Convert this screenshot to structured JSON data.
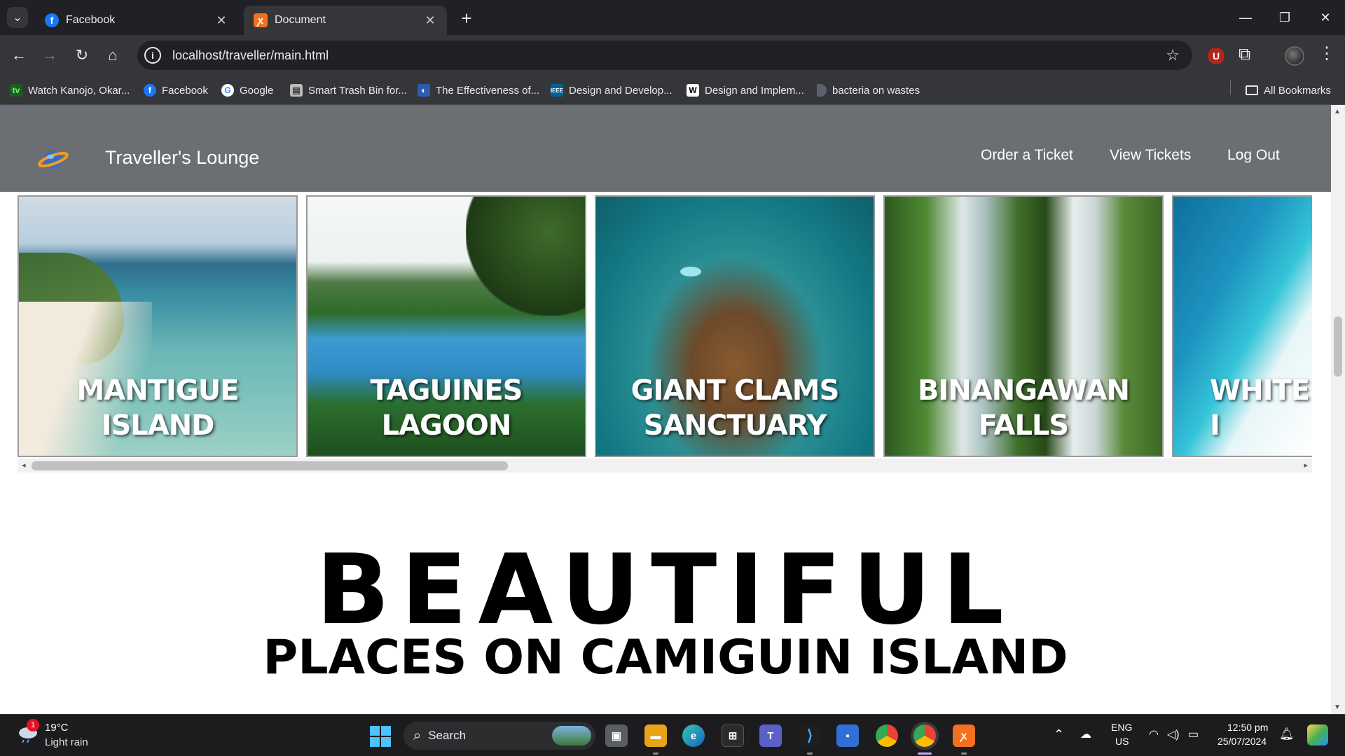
{
  "browser": {
    "tabs": [
      {
        "title": "Facebook",
        "active": false
      },
      {
        "title": "Document",
        "active": true
      }
    ],
    "url": "localhost/traveller/main.html",
    "bookmarks": [
      {
        "label": "Watch Kanojo, Okar...",
        "icon": "tv-icon"
      },
      {
        "label": "Facebook",
        "icon": "facebook-icon"
      },
      {
        "label": "Google",
        "icon": "google-icon"
      },
      {
        "label": "Smart Trash Bin for...",
        "icon": "document-icon"
      },
      {
        "label": "The Effectiveness of...",
        "icon": "globe-icon"
      },
      {
        "label": "Design and Develop...",
        "icon": "ieee-icon"
      },
      {
        "label": "Design and Implem...",
        "icon": "w-icon"
      },
      {
        "label": "bacteria on wastes",
        "icon": "bookmark-icon"
      }
    ],
    "all_bookmarks": "All Bookmarks"
  },
  "site": {
    "brand": "Traveller's Lounge",
    "nav": [
      "Order a Ticket",
      "View Tickets",
      "Log Out"
    ],
    "gallery": [
      {
        "label": "MANTIGUE ISLAND"
      },
      {
        "label": "TAGUINES LAGOON"
      },
      {
        "label": "GIANT CLAMS SANCTUARY"
      },
      {
        "label": "BINANGAWAN FALLS"
      },
      {
        "label": "WHITE I"
      }
    ],
    "hero_title": "BEAUTIFUL",
    "hero_subtitle": "PLACES ON CAMIGUIN ISLAND"
  },
  "taskbar": {
    "weather_temp": "19°C",
    "weather_desc": "Light rain",
    "weather_badge": "1",
    "search": "Search",
    "lang": "ENG",
    "region": "US",
    "time": "12:50 pm",
    "date": "25/07/2024"
  },
  "colors": {
    "header_bg": "#6b6e73",
    "browser_dark": "#202124",
    "browser_toolbar": "#35363a"
  }
}
